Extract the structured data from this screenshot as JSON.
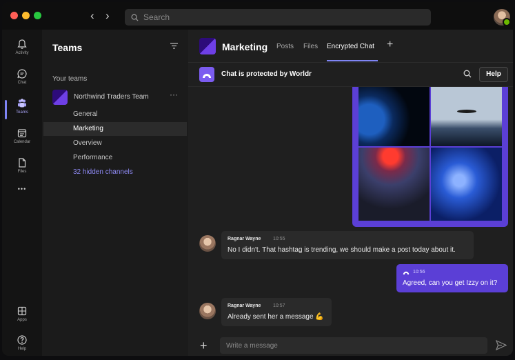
{
  "search": {
    "placeholder": "Search"
  },
  "rail": {
    "items": [
      {
        "label": "Activity",
        "icon": "bell-icon"
      },
      {
        "label": "Chat",
        "icon": "chat-icon"
      },
      {
        "label": "Teams",
        "icon": "teams-icon"
      },
      {
        "label": "Calendar",
        "icon": "calendar-icon"
      },
      {
        "label": "Files",
        "icon": "file-icon"
      },
      {
        "label": "Apps",
        "icon": "apps-icon"
      },
      {
        "label": "Help",
        "icon": "help-icon"
      }
    ],
    "more": "•••",
    "active_color": "#7f85f5"
  },
  "panel": {
    "title": "Teams",
    "section_label": "Your teams",
    "team": {
      "name": "Northwind Traders Team",
      "more": "···"
    },
    "channels": [
      "General",
      "Marketing",
      "Overview",
      "Performance"
    ],
    "hidden_channels": "32 hidden channels"
  },
  "header": {
    "title": "Marketing",
    "tabs": [
      "Posts",
      "Files",
      "Encrypted Chat"
    ],
    "add": "+"
  },
  "banner": {
    "text": "Chat is protected by Worldr",
    "help_label": "Help"
  },
  "messages": [
    {
      "author": "Ragnar Wayne",
      "time": "10:55",
      "text": "No I didn't. That hashtag is trending, we should make a post today about it."
    },
    {
      "author": "",
      "time": "10:56",
      "text": "Agreed, can you get Izzy on it?"
    },
    {
      "author": "Ragnar Wayne",
      "time": "10:57",
      "text": "Already sent her a message 💪"
    }
  ],
  "compose": {
    "placeholder": "Write a message",
    "add": "+"
  },
  "colors": {
    "accent": "#5b3fd6",
    "link": "#8f8af5",
    "background": "#1f1f1f"
  }
}
